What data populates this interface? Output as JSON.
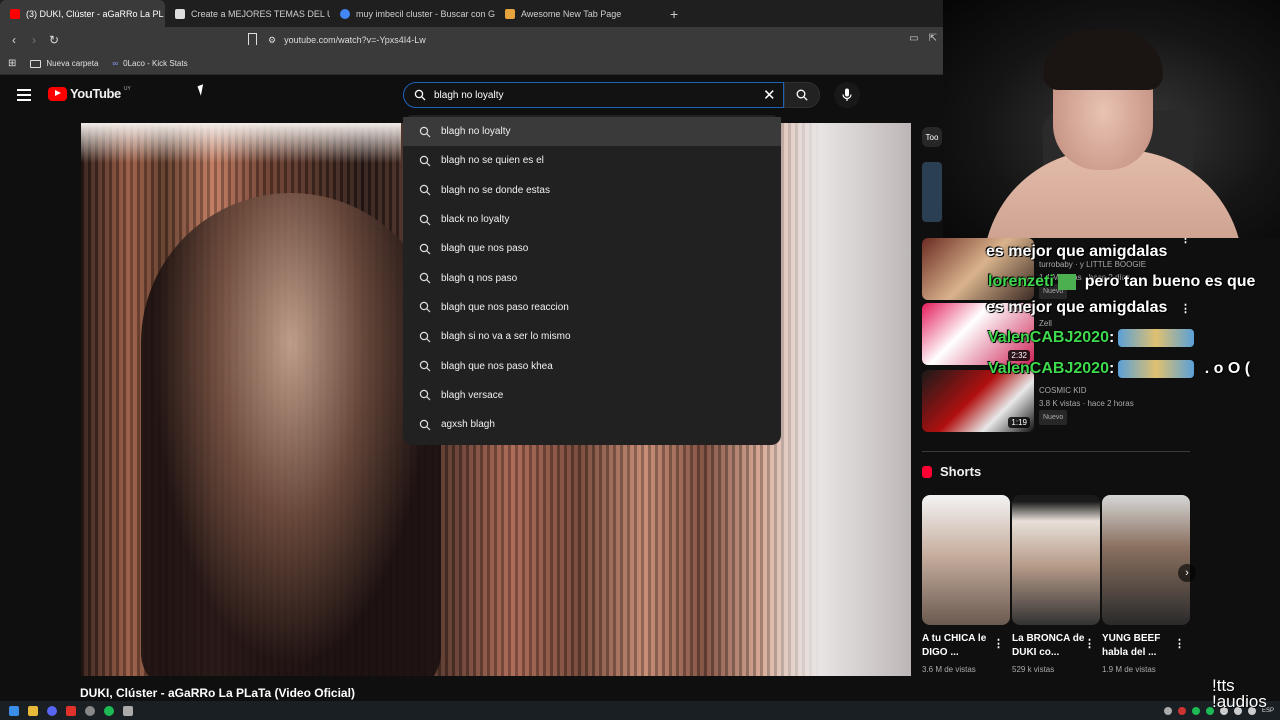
{
  "browser": {
    "tabs": [
      {
        "title": "(3) DUKI, Clúster - aGaRRo La PL",
        "active": true,
        "fav_color": "#ff0000",
        "close": "✕"
      },
      {
        "title": "Create a MEJORES TEMAS DEL UNDE",
        "active": false,
        "fav_color": "#ffffff"
      },
      {
        "title": "muy imbecil cluster - Buscar con Goo",
        "active": false,
        "fav_color": "#4285f4"
      },
      {
        "title": "Awesome New Tab Page",
        "active": false,
        "fav_color": "#e6a23c"
      }
    ],
    "new_tab": "+",
    "url": "youtube.com/watch?v=-Ypxs4I4-Lw",
    "bookmarks": [
      "Nueva carpeta",
      "0Laco - Kick Stats"
    ]
  },
  "youtube": {
    "logo_text": "YouTube",
    "country": "UY",
    "search_value": "blagh no loyalty",
    "suggestions": [
      "blagh no loyalty",
      "blagh no se quien es el",
      "blagh no se donde estas",
      "black no loyalty",
      "blagh que nos paso",
      "blagh q nos paso",
      "blagh que nos paso reaccion",
      "blagh si no va a ser lo mismo",
      "blagh que nos paso khea",
      "blagh versace",
      "agxsh blagh"
    ],
    "video_title": "DUKI, Clúster - aGaRRo La PLaTa (Video Oficial)"
  },
  "sidebar": {
    "chip_label": "Too",
    "videos": [
      {
        "channel": "turrobaby · y LITTLE BOOGIE",
        "meta": "1.4 M vistas · hace 2 días",
        "badge": "Nuevo",
        "duration": ""
      },
      {
        "channel": "Zell",
        "meta": "",
        "badge": "",
        "duration": "2:32"
      },
      {
        "channel": "COSMIC KID",
        "meta": "3.8 K vistas · hace 2 horas",
        "badge": "Nuevo",
        "duration": "1:19"
      }
    ],
    "chat": [
      {
        "text": "es mejor que amigdalas"
      },
      {
        "user": "lorenzeti",
        "text": "pero tan bueno es que"
      },
      {
        "text": "es mejor que amigdalas"
      },
      {
        "user": "ValenCABJ2020",
        "text": ":"
      },
      {
        "user": "ValenCABJ2020",
        "text": ":",
        "tail": ". o O ("
      }
    ],
    "shorts_label": "Shorts",
    "shorts": [
      {
        "title": "A tu CHICA le DIGO ...",
        "views": "3.6 M de vistas"
      },
      {
        "title": "La BRONCA de DUKI co...",
        "views": "529 k vistas"
      },
      {
        "title": "YUNG BEEF habla del ...",
        "views": "1.9 M de vistas"
      }
    ]
  },
  "taskbar": {
    "lang": "ESP",
    "overlay": "!tts\n!audios"
  }
}
